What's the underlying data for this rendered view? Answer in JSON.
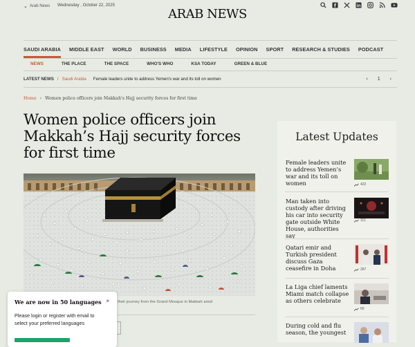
{
  "topbar": {
    "edition": "Arab News",
    "date": "Wednesday , October 22, 2025",
    "social": [
      "search-icon",
      "facebook-icon",
      "x-icon",
      "linkedin-icon",
      "instagram-icon",
      "rss-icon",
      "youtube-icon"
    ]
  },
  "logo": "ARAB NEWS",
  "nav": {
    "items": [
      "SAUDI ARABIA",
      "MIDDLE EAST",
      "WORLD",
      "BUSINESS",
      "MEDIA",
      "LIFESTYLE",
      "OPINION",
      "SPORT",
      "RESEARCH & STUDIES",
      "PODCAST"
    ],
    "active": "SAUDI ARABIA"
  },
  "subnav": {
    "items": [
      "NEWS",
      "THE PLACE",
      "THE SPACE",
      "WHO'S WHO",
      "KSA TODAY",
      "GREEN & BLUE"
    ],
    "active": "NEWS"
  },
  "latest": {
    "label": "LATEST NEWS",
    "sep": "/",
    "section": "Saudi Arabia",
    "headline": "Female leaders unite to address Yemen's war and its toll on women",
    "prev": "‹",
    "page": "1",
    "next": "›"
  },
  "breadcrumb": {
    "home": "Home",
    "sep": "›",
    "current": "Women police officers join Makkah's Hajj security forces for first time"
  },
  "article": {
    "title": "Women police officers join Makkah’s Hajj security forces for first time",
    "caption": "their journey from the Grand Mosque in Makkah amid"
  },
  "sidebar": {
    "title": "Latest Updates",
    "cards": [
      {
        "title": "Female leaders unite to address Yemen’s war and its toll on women",
        "views": "422"
      },
      {
        "title": "Man taken into custody after driving his car into security gate outside White House, authorities say",
        "views": "111"
      },
      {
        "title": "Qatari emir and Turkish president discuss Gaza ceasefire in Doha",
        "views": "397"
      },
      {
        "title": "La Liga chief laments Miami match collapse as others celebrate",
        "views": "60"
      },
      {
        "title": "During cold and flu season, the youngest",
        "views": ""
      }
    ]
  },
  "popup": {
    "heading": "We are now in 50 languages",
    "close": "×",
    "body": "Please login or register with email to select your preferred languages"
  },
  "colors": {
    "accent": "#c85a3a",
    "bg": "#e8ebe3",
    "popup_button": "#1aa56a"
  }
}
